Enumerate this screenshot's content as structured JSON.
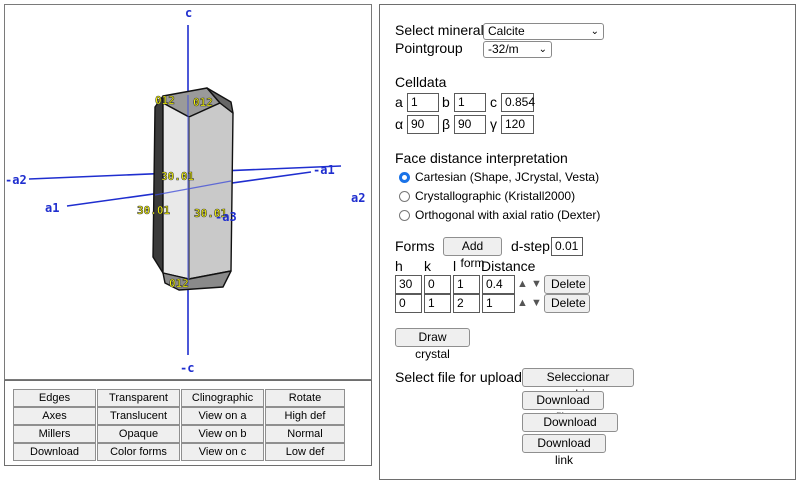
{
  "viewer": {
    "axes": {
      "c": "c",
      "neg_c": "-c",
      "a1": "a1",
      "neg_a1": "-a1",
      "a2": "a2",
      "neg_a2": "-a2",
      "neg_a3": "-a3"
    },
    "face_labels": {
      "top_left": "012",
      "top_right": "012",
      "bottom": "012",
      "mid_a": "30.01",
      "mid_b": "30.01",
      "mid_c": "30.01"
    },
    "colors": {
      "axis": "#1f2ecf",
      "label": "#ffff00"
    }
  },
  "buttons": {
    "col1": [
      "Edges",
      "Axes",
      "Millers",
      "Download"
    ],
    "col2": [
      "Transparent",
      "Translucent",
      "Opaque",
      "Color forms"
    ],
    "col3": [
      "Clinographic",
      "View on a",
      "View on b",
      "View on c"
    ],
    "col4": [
      "Rotate",
      "High def",
      "Normal",
      "Low def"
    ]
  },
  "controls": {
    "select_mineral_label": "Select mineral",
    "mineral_value": "Calcite",
    "pointgroup_label": "Pointgroup",
    "pointgroup_value": "-32/m",
    "celldata_label": "Celldata",
    "cell": {
      "a_label": "a",
      "a": "1",
      "b_label": "b",
      "b": "1",
      "c_label": "c",
      "c": "0.854",
      "alpha_label": "α",
      "alpha": "90",
      "beta_label": "β",
      "beta": "90",
      "gamma_label": "γ",
      "gamma": "120"
    },
    "face_distance_label": "Face distance interpretation",
    "radios": [
      "Cartesian (Shape, JCrystal, Vesta)",
      "Crystallographic (Kristall2000)",
      "Orthogonal with axial ratio (Dexter)"
    ],
    "selected_radio": 0,
    "forms_label": "Forms",
    "add_form": "Add form",
    "dstep_label": "d-step",
    "dstep_value": "0.01",
    "headers": {
      "h": "h",
      "k": "k",
      "l": "l",
      "distance": "Distance"
    },
    "forms": [
      {
        "h": "30",
        "k": "0",
        "l": "1",
        "d": "0.4"
      },
      {
        "h": "0",
        "k": "1",
        "l": "2",
        "d": "1"
      }
    ],
    "delete": "Delete",
    "draw_crystal": "Draw crystal",
    "upload_label": "Select file for upload:",
    "choose_file": "Seleccionar archivo",
    "download_file": "Download file",
    "download_image": "Download image",
    "download_link": "Download link"
  }
}
